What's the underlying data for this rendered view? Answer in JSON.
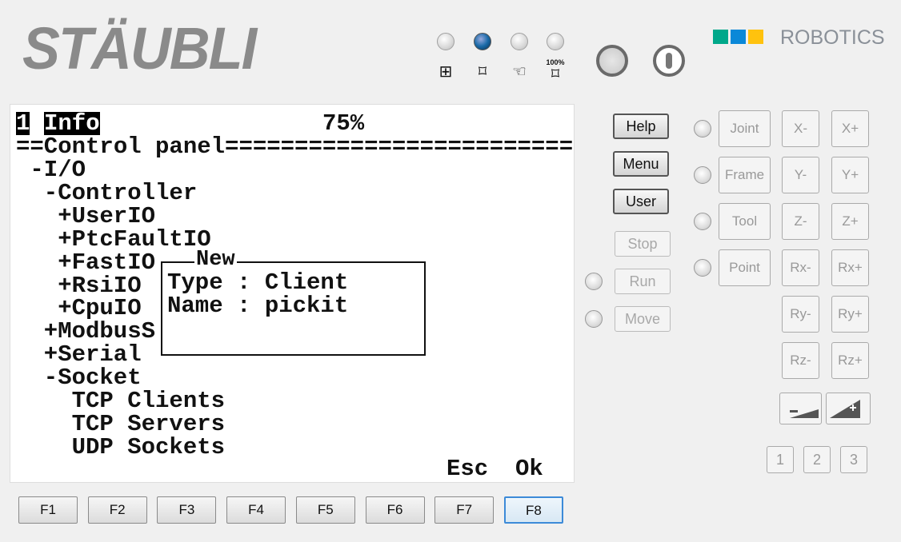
{
  "brand": {
    "logo": "STÄUBLI",
    "robotics": "ROBOTICS",
    "colors": [
      "#00a88a",
      "#0a88d8",
      "#ffc20e"
    ]
  },
  "modes": [
    {
      "icon": "network-local-icon",
      "glyph": "⊞",
      "active": false
    },
    {
      "icon": "manual-icon",
      "glyph": "⌑",
      "active": true
    },
    {
      "icon": "hand-icon",
      "glyph": "☜",
      "active": false
    },
    {
      "icon": "auto-100-icon",
      "glyph": "⌑",
      "label": "100%",
      "active": false
    }
  ],
  "screen": {
    "tab_num": "1",
    "tab_title": "Info",
    "speed": "75%",
    "header": "==Control panel=======================================",
    "tree": [
      "-I/O",
      "-Controller",
      "+UserIO",
      "+PtcFaultIO",
      "+FastIO",
      "+RsiIO",
      "+CpuIO",
      "+ModbusS",
      "+Serial",
      "-Socket",
      "TCP Clients",
      "TCP Servers",
      "UDP Sockets"
    ],
    "dialog": {
      "title": "New",
      "type_line": "Type : Client",
      "name_line": "Name : pickit"
    },
    "softkeys": [
      "Esc",
      "Ok"
    ]
  },
  "fkeys": [
    "F1",
    "F2",
    "F3",
    "F4",
    "F5",
    "F6",
    "F7",
    "F8"
  ],
  "fkeys_selected": "F8",
  "side": {
    "help": "Help",
    "menu": "Menu",
    "user": "User",
    "stop": "Stop",
    "run": "Run",
    "move": "Move"
  },
  "frames": [
    "Joint",
    "Frame",
    "Tool",
    "Point"
  ],
  "jog": [
    [
      "X-",
      "X+"
    ],
    [
      "Y-",
      "Y+"
    ],
    [
      "Z-",
      "Z+"
    ],
    [
      "Rx-",
      "Rx+"
    ],
    [
      "Ry-",
      "Ry+"
    ],
    [
      "Rz-",
      "Rz+"
    ]
  ],
  "speed_buttons": {
    "minus": "-",
    "plus": "+"
  },
  "numbers": [
    "1",
    "2",
    "3"
  ]
}
